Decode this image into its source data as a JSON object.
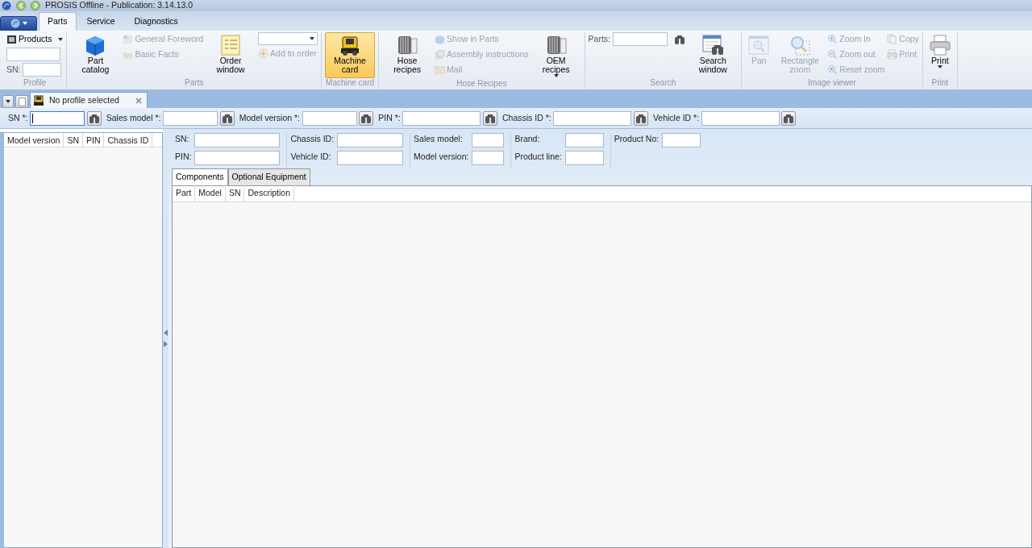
{
  "window": {
    "title": "PROSIS Offline - Publication: 3.14.13.0"
  },
  "ribbon_tabs": [
    {
      "label": "Parts",
      "selected": true
    },
    {
      "label": "Service",
      "selected": false
    },
    {
      "label": "Diagnostics",
      "selected": false
    }
  ],
  "ribbon_groups": [
    {
      "label": "Profile",
      "columns": [
        {
          "kind": "stack",
          "items": [
            {
              "kind": "dropdown",
              "label": "Products",
              "disabled": false
            },
            {
              "kind": "field"
            },
            {
              "kind": "field",
              "label": "SN:"
            }
          ]
        }
      ]
    },
    {
      "label": "Parts",
      "columns": [
        {
          "kind": "large",
          "label": "Part catalog",
          "disabled": false
        },
        {
          "kind": "stack",
          "items": [
            {
              "kind": "small",
              "label": "General Foreword",
              "disabled": true
            },
            {
              "kind": "small",
              "label": "Basic Facts",
              "disabled": true
            }
          ]
        },
        {
          "kind": "large",
          "label": "Order window",
          "disabled": false
        },
        {
          "kind": "stack",
          "items": [
            {
              "kind": "combo"
            },
            {
              "kind": "small",
              "label": "Add to order",
              "disabled": true
            }
          ]
        }
      ]
    },
    {
      "label": "Machine card",
      "columns": [
        {
          "kind": "large",
          "label": "Machine card",
          "disabled": false,
          "selected": true
        }
      ]
    },
    {
      "label": "Hose Recipes",
      "columns": [
        {
          "kind": "large",
          "label": "Hose recipes",
          "disabled": false
        },
        {
          "kind": "stack",
          "items": [
            {
              "kind": "small",
              "label": "Show in Parts",
              "disabled": true
            },
            {
              "kind": "small",
              "label": "Assembly instructions",
              "disabled": true
            },
            {
              "kind": "small",
              "label": "Mail",
              "disabled": true
            }
          ]
        },
        {
          "kind": "large",
          "label": "OEM recipes",
          "disabled": false,
          "caret": true
        }
      ]
    },
    {
      "label": "Search",
      "columns": [
        {
          "kind": "stack",
          "items": [
            {
              "kind": "search",
              "label": "Parts:"
            }
          ]
        },
        {
          "kind": "large",
          "label": "Search window",
          "disabled": false
        }
      ]
    },
    {
      "label": "Image viewer",
      "columns": [
        {
          "kind": "large",
          "label": "Pan",
          "disabled": true
        },
        {
          "kind": "large",
          "label": "Rectangle zoom",
          "disabled": true
        },
        {
          "kind": "stack",
          "items": [
            {
              "kind": "small",
              "label": "Zoom In",
              "disabled": true
            },
            {
              "kind": "small",
              "label": "Zoom out",
              "disabled": true
            },
            {
              "kind": "small",
              "label": "Reset zoom",
              "disabled": true
            }
          ]
        },
        {
          "kind": "stack",
          "items": [
            {
              "kind": "small",
              "label": "Copy",
              "disabled": true
            },
            {
              "kind": "small",
              "label": "Print",
              "disabled": true
            }
          ]
        }
      ]
    },
    {
      "label": "Print",
      "columns": [
        {
          "kind": "large",
          "label": "Print",
          "disabled": false,
          "caret": true
        }
      ]
    }
  ],
  "document_tabs": [
    {
      "label": "No profile selected",
      "selected": true
    }
  ],
  "search_fields": [
    {
      "label": "SN *:",
      "focused": true
    },
    {
      "label": "Sales model *:",
      "focused": false
    },
    {
      "label": "Model version *:",
      "focused": false
    },
    {
      "label": "PIN *:",
      "focused": false
    },
    {
      "label": "Chassis ID *:",
      "focused": false
    },
    {
      "label": "Vehicle ID *:",
      "focused": false
    }
  ],
  "results_table": {
    "columns": [
      "Model version",
      "SN",
      "PIN",
      "Chassis ID"
    ]
  },
  "details": [
    [
      {
        "label": "SN:"
      },
      {
        "label": "PIN:"
      }
    ],
    [
      {
        "label": "Chassis ID:"
      },
      {
        "label": "Vehicle ID:"
      }
    ],
    [
      {
        "label": "Sales model:"
      },
      {
        "label": "Model version:"
      }
    ],
    [
      {
        "label": "Brand:"
      },
      {
        "label": "Product line:"
      }
    ],
    [
      {
        "label": "Product No:"
      }
    ]
  ],
  "detail_tabs": [
    {
      "label": "Components",
      "selected": true
    },
    {
      "label": "Optional Equipment",
      "selected": false
    }
  ],
  "components_table": {
    "columns": [
      "Part",
      "Model",
      "SN",
      "Description"
    ]
  }
}
